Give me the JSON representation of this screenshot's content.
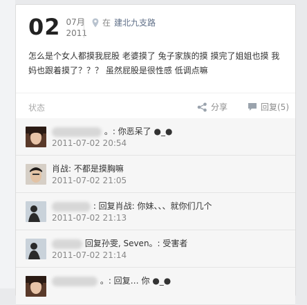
{
  "post": {
    "day": "02",
    "month": "07月",
    "year": "2011",
    "location_prefix": "在",
    "location": "建北九支路",
    "text": "怎么是个女人都摸我屁股 老婆摸了 兔子家族的摸 摸完了姐姐也摸 我妈也跟着摸了？？？ 虽然屁股是很性感 低调点嘛"
  },
  "actions": {
    "status": "状态",
    "share": "分享",
    "reply": "回复(5)"
  },
  "comments": [
    {
      "name": "",
      "text": "。: 你恶呆了 ●_●",
      "time": "2011-07-02 20:54"
    },
    {
      "name": "肖战",
      "text": ": 不都是摸胸嘛",
      "time": "2011-07-02 21:05"
    },
    {
      "name": "",
      "text": ": 回复肖战: 你妹、、、就你们几个",
      "time": "2011-07-02 21:13"
    },
    {
      "name": "",
      "text": "回复孙雯, Seven。: 受害者",
      "time": "2011-07-02 21:14"
    },
    {
      "name": "",
      "text": "。: 回复… 你 ●_●",
      "time": ""
    }
  ]
}
